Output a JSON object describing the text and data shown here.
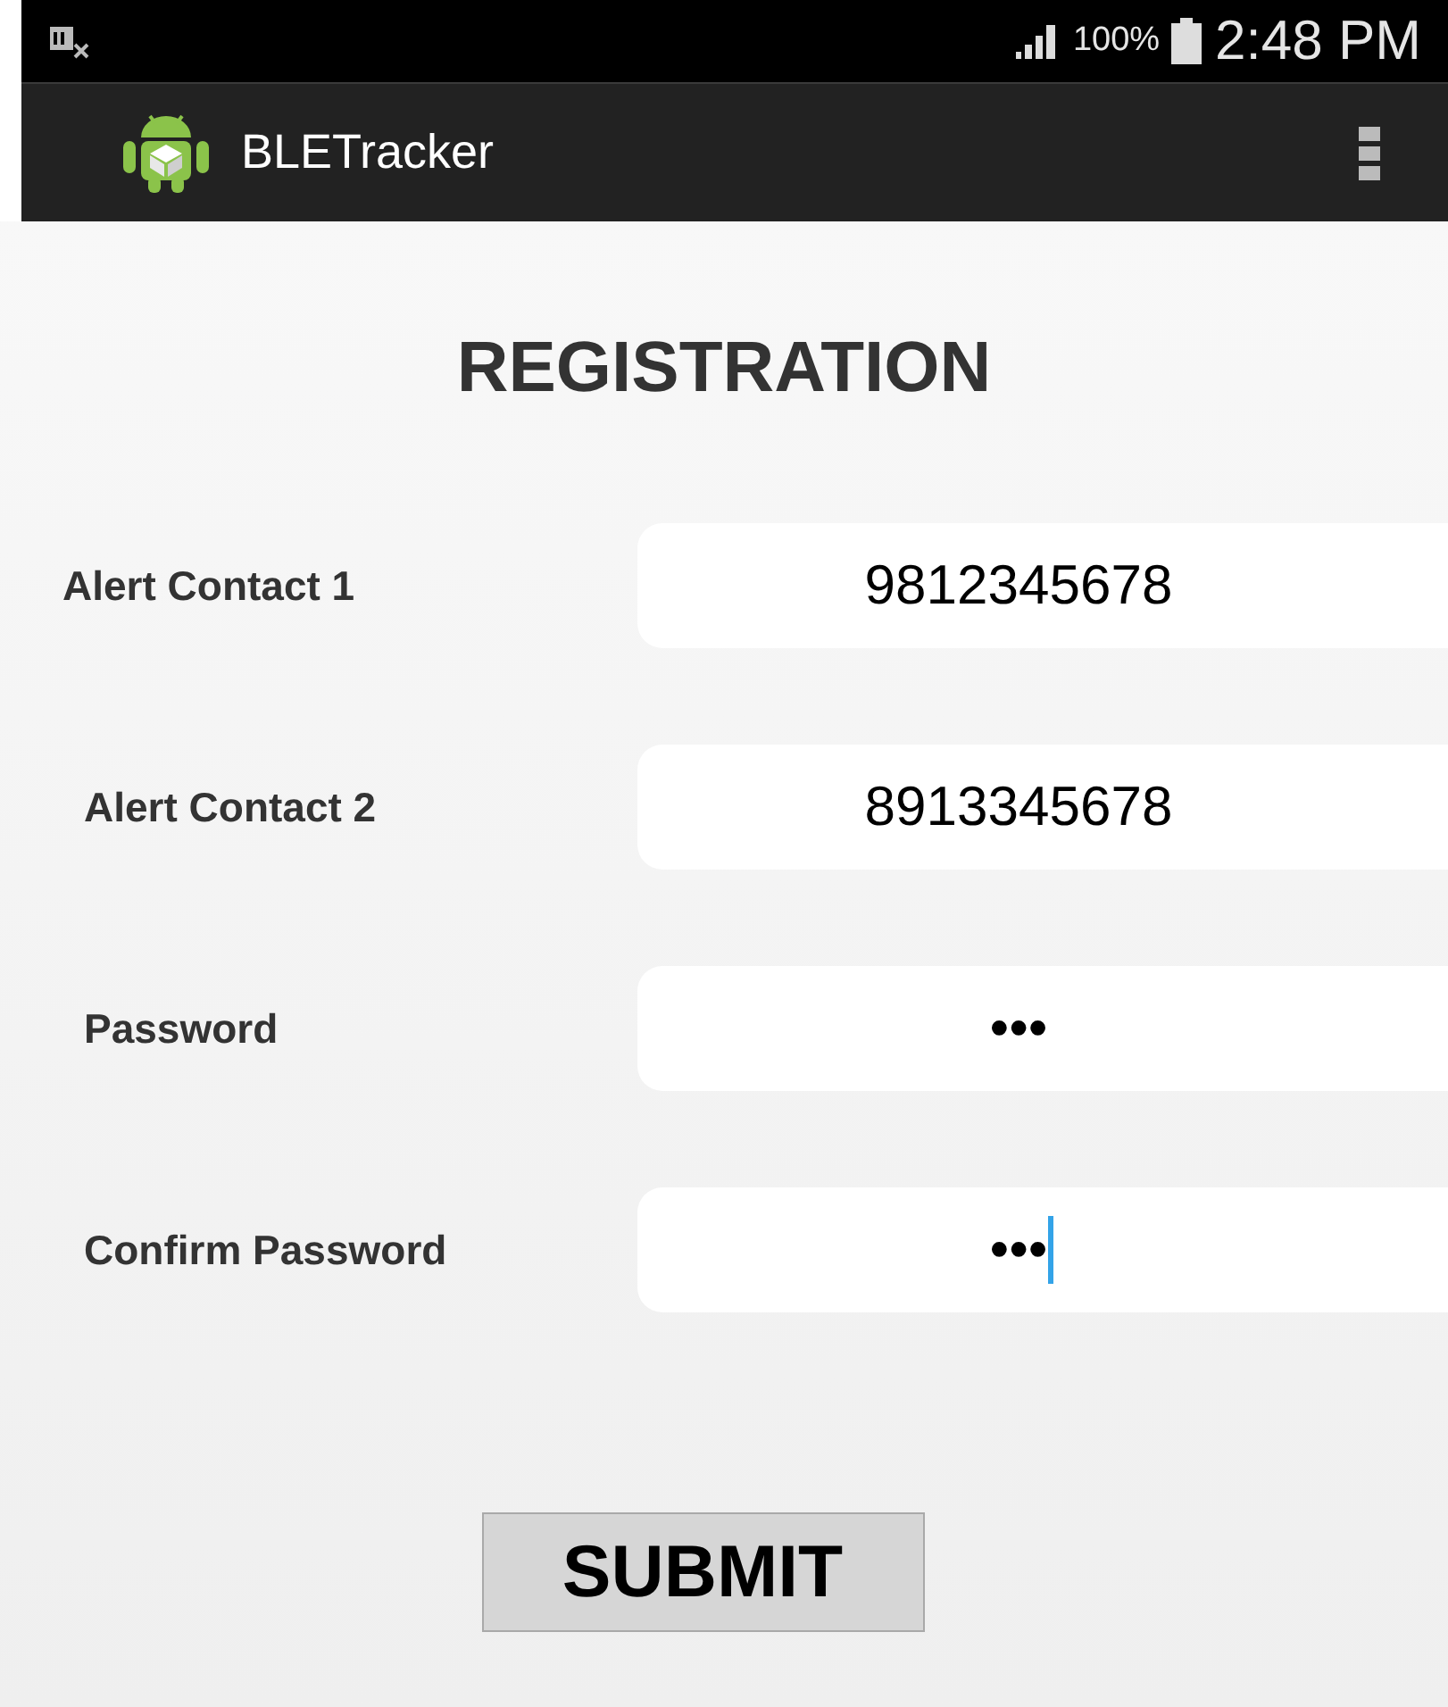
{
  "status_bar": {
    "battery": "100%",
    "time": "2:48 PM"
  },
  "app_bar": {
    "title": "BLETracker"
  },
  "heading": "REGISTRATION",
  "fields": [
    {
      "label": "Alert Contact 1",
      "value": "9812345678",
      "focused": false
    },
    {
      "label": "Alert Contact 2",
      "value": "8913345678",
      "focused": false
    },
    {
      "label": "Password",
      "value": "•••",
      "focused": false
    },
    {
      "label": "Confirm Password",
      "value": "•••",
      "focused": true
    }
  ],
  "submit": "SUBMIT"
}
